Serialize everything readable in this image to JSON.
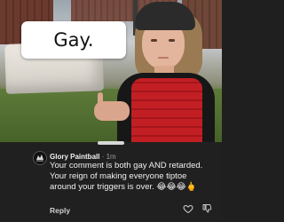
{
  "caption": {
    "text": "Gay."
  },
  "comment": {
    "author": "Glory Paintball",
    "separator": "·",
    "time": "1m",
    "text": "Your comment is both gay AND retarded. Your reign of making everyone tiptoe around your triggers is over. 😂😂😂🖕",
    "reply_label": "Reply"
  },
  "icons": {
    "avatar": "glory-paintball-logo",
    "like": "heart-icon",
    "dislike": "thumbs-down-icon"
  },
  "colors": {
    "panel_bg": "#202020",
    "vest_red": "#c21f24"
  }
}
